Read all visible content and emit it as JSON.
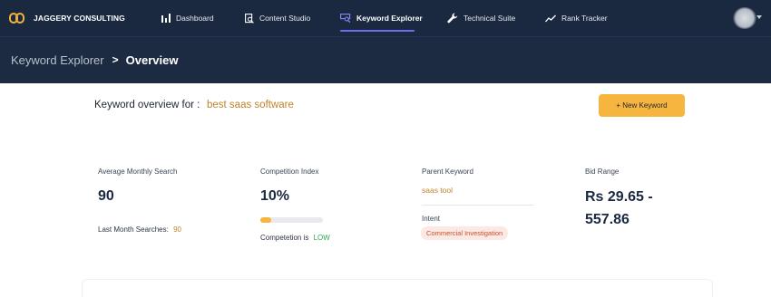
{
  "brand": {
    "name": "JAGGERY CONSULTING"
  },
  "nav": {
    "items": [
      {
        "label": "Dashboard"
      },
      {
        "label": "Content Studio"
      },
      {
        "label": "Keyword Explorer"
      },
      {
        "label": "Technical Suite"
      },
      {
        "label": "Rank Tracker"
      }
    ],
    "active_index": 2
  },
  "breadcrumb": {
    "parent": "Keyword Explorer",
    "separator": ">",
    "current": "Overview"
  },
  "overview": {
    "label": "Keyword overview for :",
    "keyword": "best saas software",
    "new_keyword_button": "+ New Keyword"
  },
  "stats": {
    "avg_monthly_search": {
      "label": "Average Monthly Search",
      "value": "90",
      "sub_label": "Last Month Searches:",
      "sub_value": "90"
    },
    "competition_index": {
      "label": "Competition Index",
      "value": "10%",
      "progress_percent": 10,
      "sub_label": "Competetion is",
      "sub_value": "LOW"
    },
    "parent_keyword": {
      "label": "Parent Keyword",
      "value": "saas tool",
      "intent_label": "Intent",
      "intent_value": "Commercial Investigation"
    },
    "bid_range": {
      "label": "Bid Range",
      "line1": "Rs 29.65 -",
      "line2": "557.86"
    }
  },
  "colors": {
    "nav_bg": "#1b2940",
    "accent": "#f5b53f",
    "keyword_gold": "#c0822b",
    "active_underline": "#6f6cf0",
    "low_green": "#2daa56",
    "intent_badge_bg": "#fde9e3"
  }
}
